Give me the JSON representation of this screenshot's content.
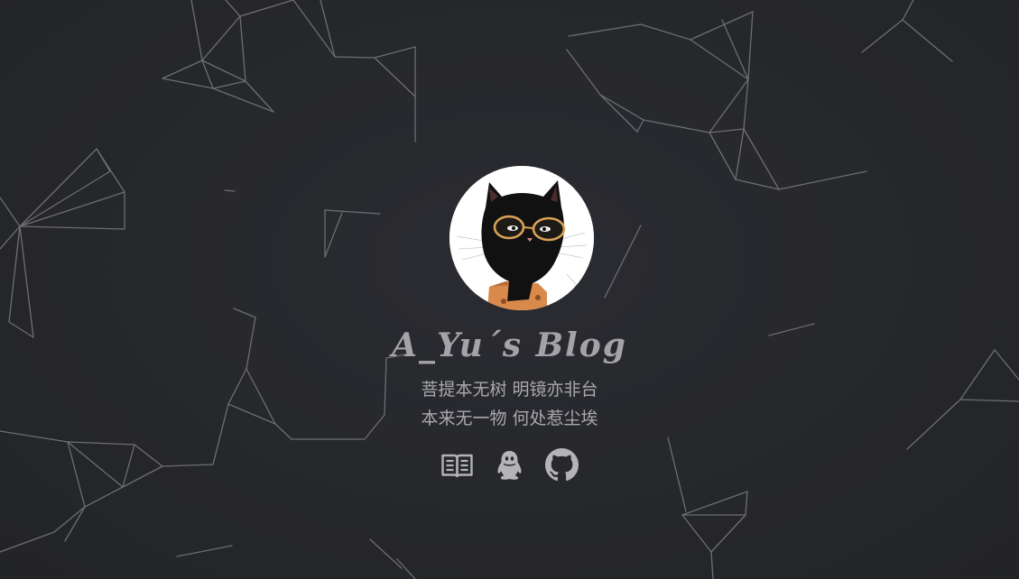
{
  "profile": {
    "title": "A_Yu´s Blog",
    "motto_line1": "菩提本无树 明镜亦非台",
    "motto_line2": "本来无一物 何处惹尘埃",
    "avatar_icon": "black-cat-with-glasses-in-box"
  },
  "social_links": [
    {
      "icon": "book-icon"
    },
    {
      "icon": "qq-icon"
    },
    {
      "icon": "github-icon"
    }
  ],
  "colors": {
    "background": "#27282c",
    "text": "#a8a8ad",
    "lines": "#6d6e74"
  }
}
